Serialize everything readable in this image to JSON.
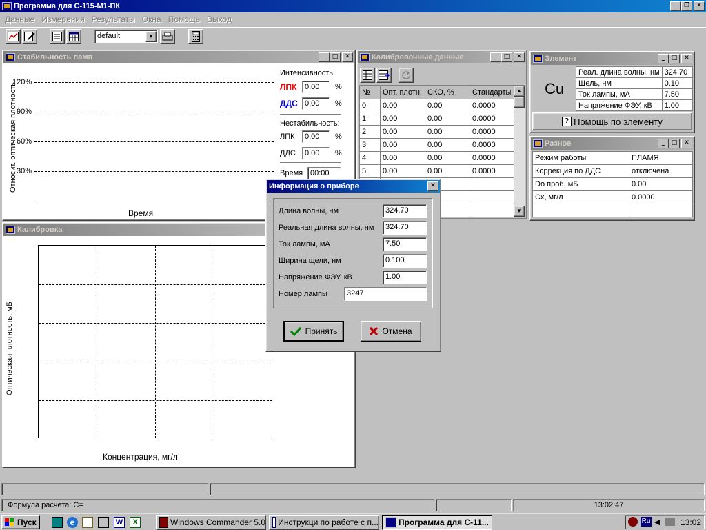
{
  "app": {
    "title": "Программа для С-115-М1-ПК",
    "menu": [
      "Данные",
      "Измерения",
      "Результаты",
      "Окна",
      "Помощь",
      "Выход"
    ],
    "toolbar": {
      "profile_value": "default"
    }
  },
  "stability": {
    "title": "Стабильность ламп",
    "y_label": "Относит. оптическая плотность",
    "x_label": "Время",
    "y_ticks": [
      "120%",
      "90%",
      "60%",
      "30%"
    ],
    "intensity_label": "Интенсивность:",
    "lpk_label": "ЛПК",
    "dds_label": "ДДС",
    "lpk_intensity": "0.00",
    "dds_intensity": "0.00",
    "percent": "%",
    "instability_label": "Нестабильность:",
    "lpk_instability": "0.00",
    "dds_instability": "0.00",
    "time_label": "Время",
    "time_value": "00:00"
  },
  "calibration": {
    "title": "Калибровка",
    "y_label": "Оптическая плотность, мБ",
    "x_label": "Концентрация, мг/л"
  },
  "calib_data": {
    "title": "Калибровочные данные",
    "headers": [
      "№",
      "Опт. плотн.",
      "СКО, %",
      "Стандарты"
    ],
    "rows": [
      [
        "0",
        "0.00",
        "0.00",
        "0.0000"
      ],
      [
        "1",
        "0.00",
        "0.00",
        "0.0000"
      ],
      [
        "2",
        "0.00",
        "0.00",
        "0.0000"
      ],
      [
        "3",
        "0.00",
        "0.00",
        "0.0000"
      ],
      [
        "4",
        "0.00",
        "0.00",
        "0.0000"
      ],
      [
        "5",
        "0.00",
        "0.00",
        "0.0000"
      ]
    ]
  },
  "element": {
    "title": "Элемент",
    "symbol": "Cu",
    "rows": [
      {
        "label": "Реал. длина волны, нм",
        "value": "324.70"
      },
      {
        "label": "Щель, нм",
        "value": "0.10"
      },
      {
        "label": "Ток лампы, мА",
        "value": "7.50"
      },
      {
        "label": "Напряжение ФЭУ, кВ",
        "value": "1.00"
      }
    ],
    "help_button": "Помощь по элементу"
  },
  "misc": {
    "title": "Разное",
    "rows": [
      {
        "label": "Режим работы",
        "value": "ПЛАМЯ"
      },
      {
        "label": "Коррекция по ДДС",
        "value": "отключена"
      },
      {
        "label": "Do проб, мБ",
        "value": "0.00"
      },
      {
        "label": "Cx, мг/л",
        "value": "0.0000"
      }
    ]
  },
  "dialog": {
    "title": "Информация о приборе",
    "fields": [
      {
        "label": "Длина волны, нм",
        "value": "324.70"
      },
      {
        "label": "Реальная длина волны, нм",
        "value": "324.70"
      },
      {
        "label": "Ток лампы, мА",
        "value": "7.50"
      },
      {
        "label": "Ширина щели, нм",
        "value": "0.100"
      },
      {
        "label": "Напряжение ФЭУ, кВ",
        "value": "1.00"
      }
    ],
    "lamp_label": "Номер лампы",
    "lamp_value": "3247",
    "ok_label": "Принять",
    "cancel_label": "Отмена"
  },
  "status": {
    "formula": "Формула расчета: С=",
    "time": "13:02:47"
  },
  "taskbar": {
    "start": "Пуск",
    "tasks": [
      "Windows Commander 5.0",
      "Инструкци по работе с п...",
      "Программа для С-11..."
    ],
    "lang": "Ru",
    "clock": "13:02"
  },
  "colors": {
    "title_active": "#000080",
    "desktop": "#808080",
    "lpk": "#ff0000",
    "dds": "#0000c0"
  }
}
